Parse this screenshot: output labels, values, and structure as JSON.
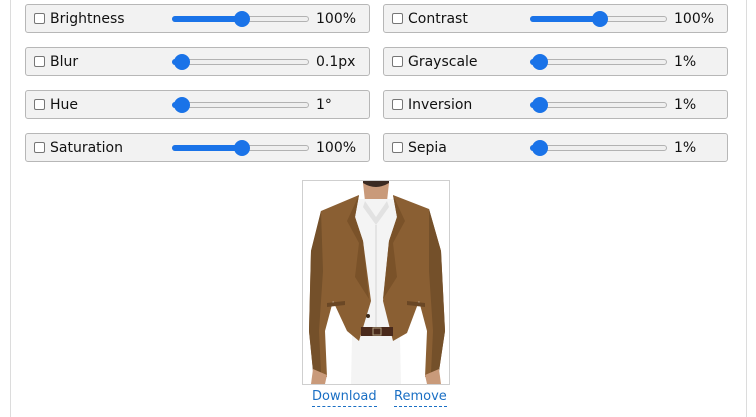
{
  "filters": [
    {
      "label": "Brightness",
      "value": "100%",
      "level": 0.5
    },
    {
      "label": "Contrast",
      "value": "100%",
      "level": 0.5
    },
    {
      "label": "Blur",
      "value": "0.1px",
      "level": 0.0
    },
    {
      "label": "Grayscale",
      "value": "1%",
      "level": 0.0
    },
    {
      "label": "Hue",
      "value": "1°",
      "level": 0.0
    },
    {
      "label": "Inversion",
      "value": "1%",
      "level": 0.0
    },
    {
      "label": "Saturation",
      "value": "100%",
      "level": 0.5
    },
    {
      "label": "Sepia",
      "value": "1%",
      "level": 0.0
    }
  ],
  "image": {
    "subject": "brown-blazer-photo"
  },
  "actions": {
    "download_label": "Download",
    "remove_label": "Remove"
  },
  "colors": {
    "accent": "#1a73e8",
    "link": "#1a6fc4",
    "blazer": "#8a5f33"
  }
}
